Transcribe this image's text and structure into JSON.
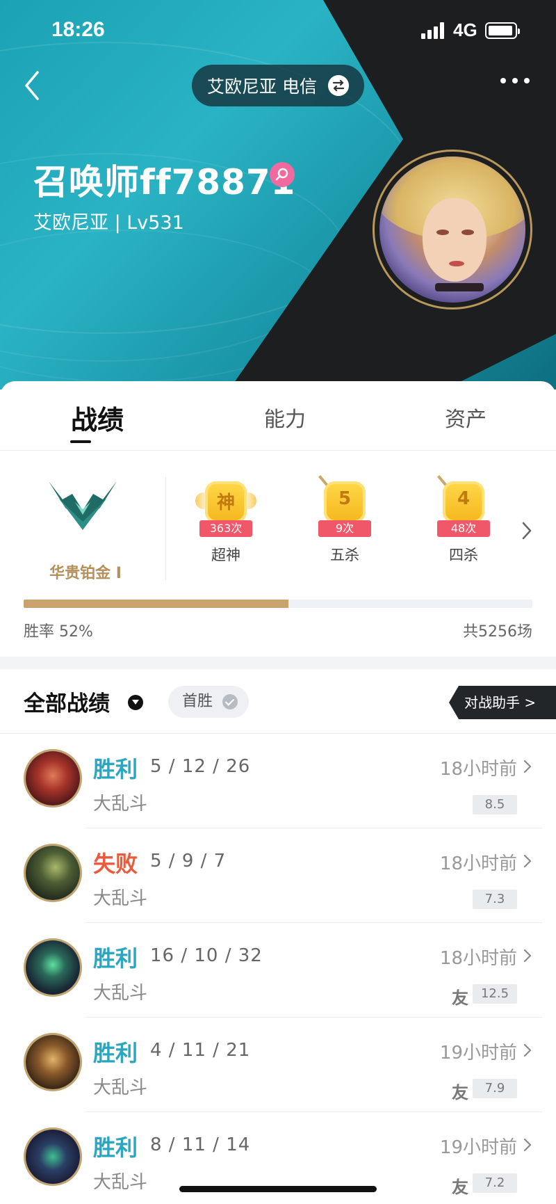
{
  "status_bar": {
    "time": "18:26",
    "network": "4G"
  },
  "header": {
    "server_label": "艾欧尼亚 电信",
    "summoner_name": "召唤师ff78871",
    "region_level": "艾欧尼亚 | Lv531",
    "icons": [
      "back-arrow-icon",
      "swap-icon",
      "more-icon",
      "female-icon"
    ]
  },
  "tabs": [
    {
      "label": "战绩",
      "active": true
    },
    {
      "label": "能力",
      "active": false
    },
    {
      "label": "资产",
      "active": false
    }
  ],
  "rank": {
    "name": "华贵铂金 I"
  },
  "achievements": [
    {
      "glyph": "神",
      "count": "363次",
      "label": "超神"
    },
    {
      "glyph": "5",
      "count": "9次",
      "label": "五杀"
    },
    {
      "glyph": "4",
      "count": "48次",
      "label": "四杀"
    }
  ],
  "stats": {
    "win_rate_label": "胜率 52%",
    "win_rate": 0.52,
    "total_games": "共5256场"
  },
  "filter": {
    "title": "全部战绩",
    "first_win": "首胜",
    "assistant": "对战助手 >"
  },
  "matches": [
    {
      "result": "胜利",
      "outcome": "win",
      "kda": "5 / 12 / 26",
      "mode": "大乱斗",
      "time": "18小时前",
      "score": "8.5",
      "friend": ""
    },
    {
      "result": "失败",
      "outcome": "lose",
      "kda": "5 / 9 / 7",
      "mode": "大乱斗",
      "time": "18小时前",
      "score": "7.3",
      "friend": ""
    },
    {
      "result": "胜利",
      "outcome": "win",
      "kda": "16 / 10 / 32",
      "mode": "大乱斗",
      "time": "18小时前",
      "score": "12.5",
      "friend": "友"
    },
    {
      "result": "胜利",
      "outcome": "win",
      "kda": "4 / 11 / 21",
      "mode": "大乱斗",
      "time": "19小时前",
      "score": "7.9",
      "friend": "友"
    },
    {
      "result": "胜利",
      "outcome": "win",
      "kda": "8 / 11 / 14",
      "mode": "大乱斗",
      "time": "19小时前",
      "score": "7.2",
      "friend": "友"
    }
  ],
  "colors": {
    "win": "#2aa6bf",
    "lose": "#ec5a3c",
    "gold": "#c8a36e",
    "header_teal": "#1ba2b4",
    "header_dark": "#1d1e20"
  }
}
